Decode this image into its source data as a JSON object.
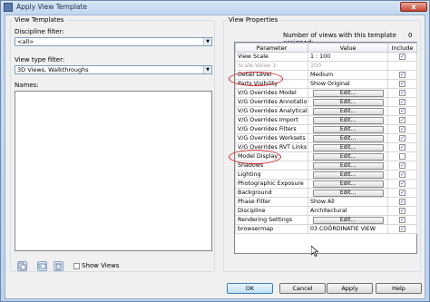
{
  "window": {
    "title": "Apply View Template",
    "close_glyph": "x"
  },
  "view_templates": {
    "group_label": "View Templates",
    "discipline_label": "Discipline filter:",
    "discipline_value": "<all>",
    "view_type_label": "View type filter:",
    "view_type_value": "3D Views, Walkthroughs",
    "names_label": "Names:",
    "show_views_label": "Show Views"
  },
  "view_properties": {
    "group_label": "View Properties",
    "assigned_label": "Number of views with this template assigned:",
    "assigned_count": "0",
    "headers": {
      "parameter": "Parameter",
      "value": "Value",
      "include": "Include"
    },
    "rows": [
      {
        "parameter": "View Scale",
        "value": "1 : 100",
        "kind": "text",
        "include": true,
        "disabled": false
      },
      {
        "parameter": "Scale Value   1:",
        "value": "100",
        "kind": "text",
        "include": null,
        "disabled": true
      },
      {
        "parameter": "Detail Level",
        "value": "Medium",
        "kind": "text",
        "include": true,
        "disabled": false
      },
      {
        "parameter": "Parts Visibility",
        "value": "Show Original",
        "kind": "text",
        "include": true,
        "disabled": false
      },
      {
        "parameter": "V/G Overrides Model",
        "value": "Edit...",
        "kind": "button",
        "include": true,
        "disabled": false
      },
      {
        "parameter": "V/G Overrides Annotation",
        "value": "Edit...",
        "kind": "button",
        "include": true,
        "disabled": false
      },
      {
        "parameter": "V/G Overrides Analytical",
        "value": "Edit...",
        "kind": "button",
        "include": true,
        "disabled": false
      },
      {
        "parameter": "V/G Overrides Import",
        "value": "Edit...",
        "kind": "button",
        "include": true,
        "disabled": false
      },
      {
        "parameter": "V/G Overrides Filters",
        "value": "Edit...",
        "kind": "button",
        "include": true,
        "disabled": false
      },
      {
        "parameter": "V/G Overrides Worksets",
        "value": "Edit...",
        "kind": "button",
        "include": true,
        "disabled": false
      },
      {
        "parameter": "V/G Overrides RVT Links",
        "value": "Edit...",
        "kind": "button",
        "include": true,
        "disabled": false
      },
      {
        "parameter": "Model Display",
        "value": "Edit...",
        "kind": "button",
        "include": false,
        "disabled": false
      },
      {
        "parameter": "Shadows",
        "value": "Edit...",
        "kind": "button",
        "include": true,
        "disabled": false
      },
      {
        "parameter": "Lighting",
        "value": "Edit...",
        "kind": "button",
        "include": true,
        "disabled": false
      },
      {
        "parameter": "Photographic Exposure",
        "value": "Edit...",
        "kind": "button",
        "include": true,
        "disabled": false
      },
      {
        "parameter": "Background",
        "value": "Edit...",
        "kind": "button",
        "include": true,
        "disabled": false
      },
      {
        "parameter": "Phase Filter",
        "value": "Show All",
        "kind": "text",
        "include": true,
        "disabled": false
      },
      {
        "parameter": "Discipline",
        "value": "Architectural",
        "kind": "text",
        "include": true,
        "disabled": false
      },
      {
        "parameter": "Rendering Settings",
        "value": "Edit...",
        "kind": "button",
        "include": true,
        "disabled": false
      },
      {
        "parameter": "browsermap",
        "value": "03 COÖRDINATIE VIEW",
        "kind": "text",
        "include": true,
        "disabled": false
      }
    ]
  },
  "buttons": {
    "ok": "OK",
    "cancel": "Cancel",
    "apply": "Apply",
    "help": "Help"
  },
  "colors": {
    "highlight_ellipse": "#d12a2a",
    "check": "#2a4f9e"
  }
}
